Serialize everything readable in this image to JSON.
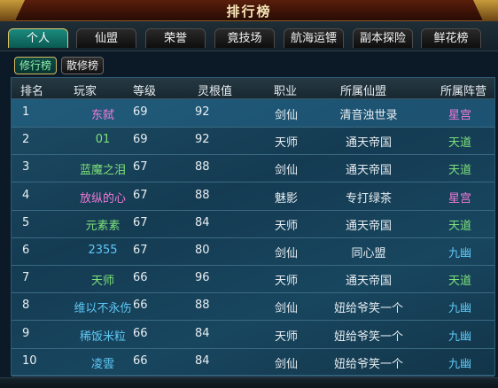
{
  "window": {
    "title": "排行榜"
  },
  "tabs": [
    {
      "label": "个人",
      "active": true
    },
    {
      "label": "仙盟",
      "active": false
    },
    {
      "label": "荣誉",
      "active": false
    },
    {
      "label": "竟技场",
      "active": false
    },
    {
      "label": "航海运镖",
      "active": false
    },
    {
      "label": "副本探险",
      "active": false
    },
    {
      "label": "鲜花榜",
      "active": false
    }
  ],
  "subtabs": [
    {
      "label": "修行榜",
      "active": true
    },
    {
      "label": "散修榜",
      "active": false
    }
  ],
  "table": {
    "headers": [
      "排名",
      "玩家",
      "等级",
      "灵根值",
      "职业",
      "所属仙盟",
      "所属阵营"
    ],
    "rows": [
      {
        "rank": "1",
        "player": "东弑",
        "level": "69",
        "score": "92",
        "job": "剑仙",
        "guild": "清音浊世录",
        "camp": "星宫",
        "player_color": "#f07ad8",
        "camp_color": "#f07ad8"
      },
      {
        "rank": "2",
        "player": "01",
        "level": "69",
        "score": "92",
        "job": "天师",
        "guild": "通天帝国",
        "camp": "天道",
        "player_color": "#7ee07a",
        "camp_color": "#7ee07a"
      },
      {
        "rank": "3",
        "player": "蓝魔之泪",
        "level": "67",
        "score": "88",
        "job": "剑仙",
        "guild": "通天帝国",
        "camp": "天道",
        "player_color": "#7ee07a",
        "camp_color": "#7ee07a"
      },
      {
        "rank": "4",
        "player": "放纵的心",
        "level": "67",
        "score": "88",
        "job": "魅影",
        "guild": "专打绿茶",
        "camp": "星宫",
        "player_color": "#f07ad8",
        "camp_color": "#f07ad8"
      },
      {
        "rank": "5",
        "player": "元素素",
        "level": "67",
        "score": "84",
        "job": "天师",
        "guild": "通天帝国",
        "camp": "天道",
        "player_color": "#7ee07a",
        "camp_color": "#7ee07a"
      },
      {
        "rank": "6",
        "player": "2355",
        "level": "67",
        "score": "80",
        "job": "剑仙",
        "guild": "同心盟",
        "camp": "九幽",
        "player_color": "#5fc8f5",
        "camp_color": "#5fc8f5"
      },
      {
        "rank": "7",
        "player": "天师",
        "level": "66",
        "score": "96",
        "job": "天师",
        "guild": "通天帝国",
        "camp": "天道",
        "player_color": "#7ee07a",
        "camp_color": "#7ee07a"
      },
      {
        "rank": "8",
        "player": "维以不永伤",
        "level": "66",
        "score": "88",
        "job": "剑仙",
        "guild": "妞给爷笑一个",
        "camp": "九幽",
        "player_color": "#5fc8f5",
        "camp_color": "#5fc8f5"
      },
      {
        "rank": "9",
        "player": "稀饭米粒",
        "level": "66",
        "score": "84",
        "job": "天师",
        "guild": "妞给爷笑一个",
        "camp": "九幽",
        "player_color": "#5fc8f5",
        "camp_color": "#5fc8f5"
      },
      {
        "rank": "10",
        "player": "凌雲",
        "level": "66",
        "score": "84",
        "job": "剑仙",
        "guild": "妞给爷笑一个",
        "camp": "九幽",
        "player_color": "#5fc8f5",
        "camp_color": "#5fc8f5"
      }
    ]
  }
}
